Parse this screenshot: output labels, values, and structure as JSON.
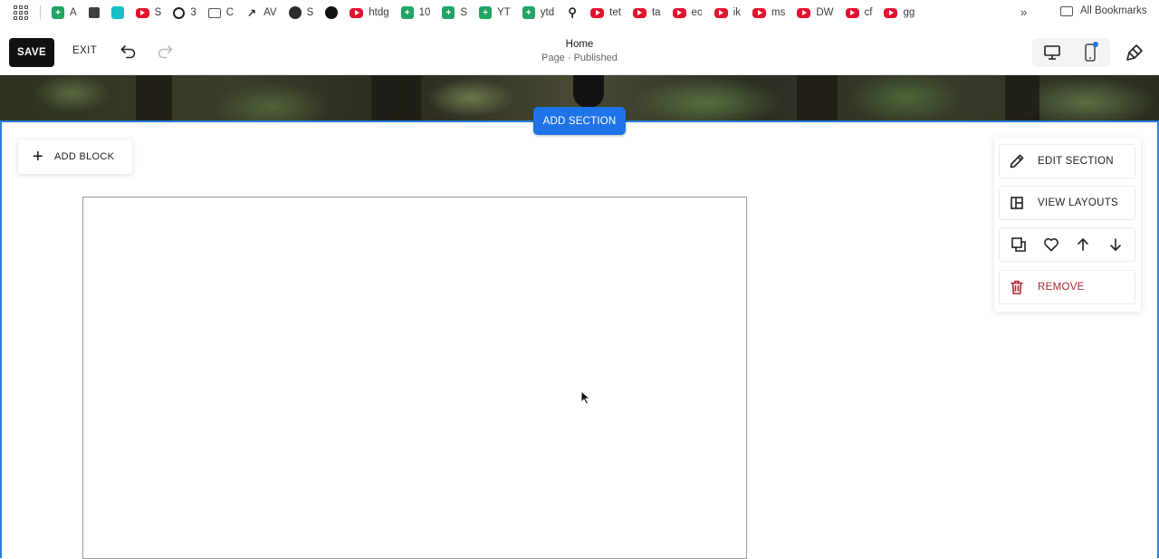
{
  "bookmarks": {
    "items": [
      {
        "icon": "sheets-icon",
        "label": "A"
      },
      {
        "icon": "puzzle-icon",
        "label": ""
      },
      {
        "icon": "canva-icon",
        "label": ""
      },
      {
        "icon": "youtube-icon",
        "label": "S"
      },
      {
        "icon": "threads-icon",
        "label": "3"
      },
      {
        "icon": "folder-icon",
        "label": "C"
      },
      {
        "icon": "trend-chart-icon",
        "label": "AV"
      },
      {
        "icon": "globe-icon",
        "label": "S"
      },
      {
        "icon": "github-icon",
        "label": ""
      },
      {
        "icon": "youtube-icon",
        "label": "htdg"
      },
      {
        "icon": "sheets-icon",
        "label": "10"
      },
      {
        "icon": "sheets-icon",
        "label": "S"
      },
      {
        "icon": "sheets-icon",
        "label": "YT"
      },
      {
        "icon": "sheets-icon",
        "label": "ytd"
      },
      {
        "icon": "pin-icon",
        "label": ""
      },
      {
        "icon": "youtube-icon",
        "label": "tet"
      },
      {
        "icon": "youtube-icon",
        "label": "ta"
      },
      {
        "icon": "youtube-icon",
        "label": "ec"
      },
      {
        "icon": "youtube-icon",
        "label": "ik"
      },
      {
        "icon": "youtube-icon",
        "label": "ms"
      },
      {
        "icon": "youtube-icon",
        "label": "DW"
      },
      {
        "icon": "youtube-icon",
        "label": "cf"
      },
      {
        "icon": "youtube-icon",
        "label": "gg"
      }
    ],
    "more": "»",
    "all_bookmarks": "All Bookmarks"
  },
  "toolbar": {
    "save_label": "SAVE",
    "exit_label": "EXIT",
    "page_title": "Home",
    "page_status": "Page · Published"
  },
  "editor": {
    "add_section_label": "ADD SECTION",
    "add_block_label": "ADD BLOCK"
  },
  "section_panel": {
    "edit_section_label": "EDIT SECTION",
    "view_layouts_label": "VIEW LAYOUTS",
    "remove_label": "REMOVE"
  },
  "colors": {
    "accent": "#1f73e8",
    "remove": "#b12431",
    "save_bg": "#111111"
  }
}
